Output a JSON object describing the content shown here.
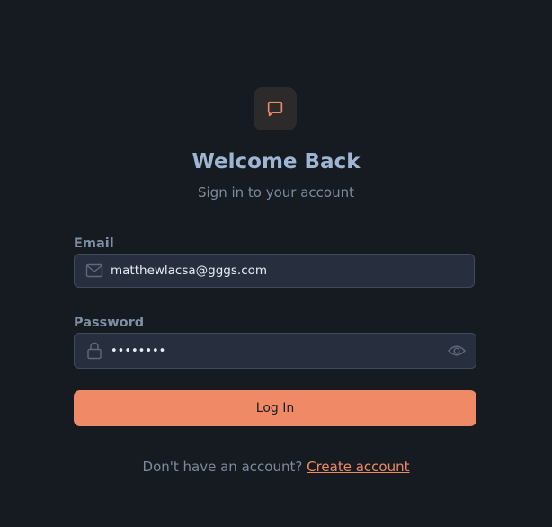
{
  "header": {
    "logo_icon": "chat-bubble-icon",
    "title": "Welcome Back",
    "subtitle": "Sign in to your account"
  },
  "form": {
    "email": {
      "label": "Email",
      "value": "matthewlacsa@gggs.com",
      "icon": "mail-icon"
    },
    "password": {
      "label": "Password",
      "value": "••••••••",
      "icon": "lock-icon",
      "toggle_icon": "eye-icon"
    },
    "submit_label": "Log In"
  },
  "footer": {
    "prompt": "Don't have an account?",
    "link_label": "Create account"
  },
  "colors": {
    "background": "#161b22",
    "accent": "#f08a66",
    "title": "#9fb6d2",
    "input_bg": "#272f3e"
  }
}
